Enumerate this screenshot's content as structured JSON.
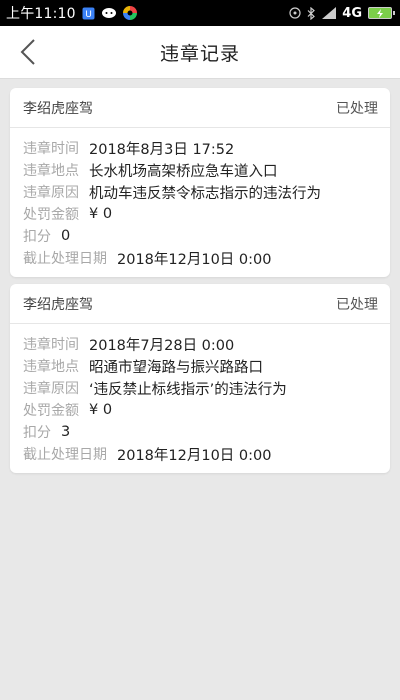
{
  "status_bar": {
    "time": "上午11:10",
    "network": "4G",
    "battery_icon": "battery-charging-icon"
  },
  "nav": {
    "title": "违章记录",
    "back_icon": "chevron-left-icon"
  },
  "labels": {
    "time": "违章时间",
    "place": "违章地点",
    "reason": "违章原因",
    "fine": "处罚金额",
    "points": "扣分",
    "deadline": "截止处理日期"
  },
  "records": [
    {
      "driver": "李绍虎座驾",
      "status": "已处理",
      "time": "2018年8月3日 17:52",
      "place": "长水机场高架桥应急车道入口",
      "reason": "机动车违反禁令标志指示的违法行为",
      "fine": "¥ 0",
      "points": "0",
      "deadline": "2018年12月10日 0:00"
    },
    {
      "driver": "李绍虎座驾",
      "status": "已处理",
      "time": "2018年7月28日 0:00",
      "place": "昭通市望海路与振兴路路口",
      "reason": "‘违反禁止标线指示’的违法行为",
      "fine": "¥ 0",
      "points": "3",
      "deadline": "2018年12月10日 0:00"
    }
  ],
  "colors": {
    "background": "#e8e8e8",
    "label": "#a8a8a8",
    "text": "#222222"
  }
}
